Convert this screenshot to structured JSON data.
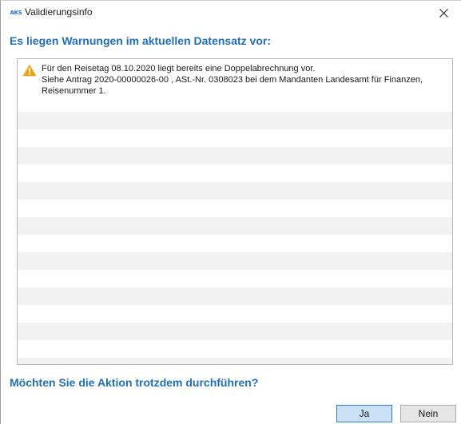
{
  "window": {
    "app_icon_text": "AKS",
    "title": "Validierungsinfo"
  },
  "heading": "Es liegen Warnungen im aktuellen Datensatz vor:",
  "warnings": [
    {
      "icon": "warning-icon",
      "lines": [
        "Für den Reisetag 08.10.2020 liegt bereits eine Doppelabrechnung vor.",
        "Siehe Antrag 2020-00000026-00 , ASt.-Nr. 0308023 bei dem Mandanten Landesamt für Finanzen,",
        "Reisenummer 1."
      ]
    }
  ],
  "question": "Möchten Sie die Aktion trotzdem durchführen?",
  "buttons": {
    "yes": "Ja",
    "no": "Nein"
  },
  "colors": {
    "heading": "#1f6fb8",
    "warning": "#f0a30a",
    "primary_button_border": "#2b7cd3",
    "primary_button_bg": "#c9e0f7"
  }
}
